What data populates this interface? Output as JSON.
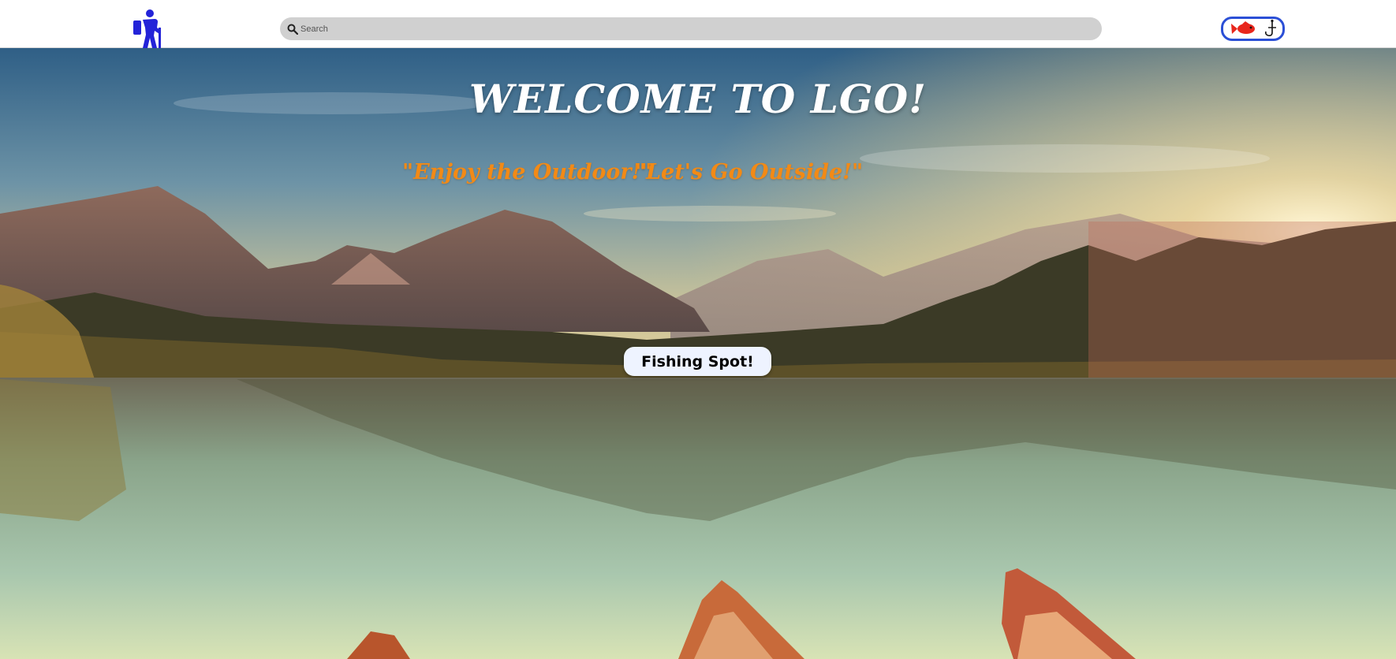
{
  "header": {
    "logo_icon": "hiker-icon",
    "search": {
      "placeholder": "Search",
      "icon": "search-icon"
    },
    "fishing_button_icon": "fish-hook-icon"
  },
  "hero": {
    "title": "WELCOME TO LGO!",
    "taglines": [
      "\"Enjoy the Outdoor!\"",
      "\"Let's Go Outside!\""
    ],
    "cta_label": "Fishing Spot!"
  },
  "colors": {
    "accent_blue": "#2b4fd6",
    "tagline_orange": "#f28a16",
    "fish_red": "#e8261c",
    "search_bg": "#d0d0d0"
  }
}
